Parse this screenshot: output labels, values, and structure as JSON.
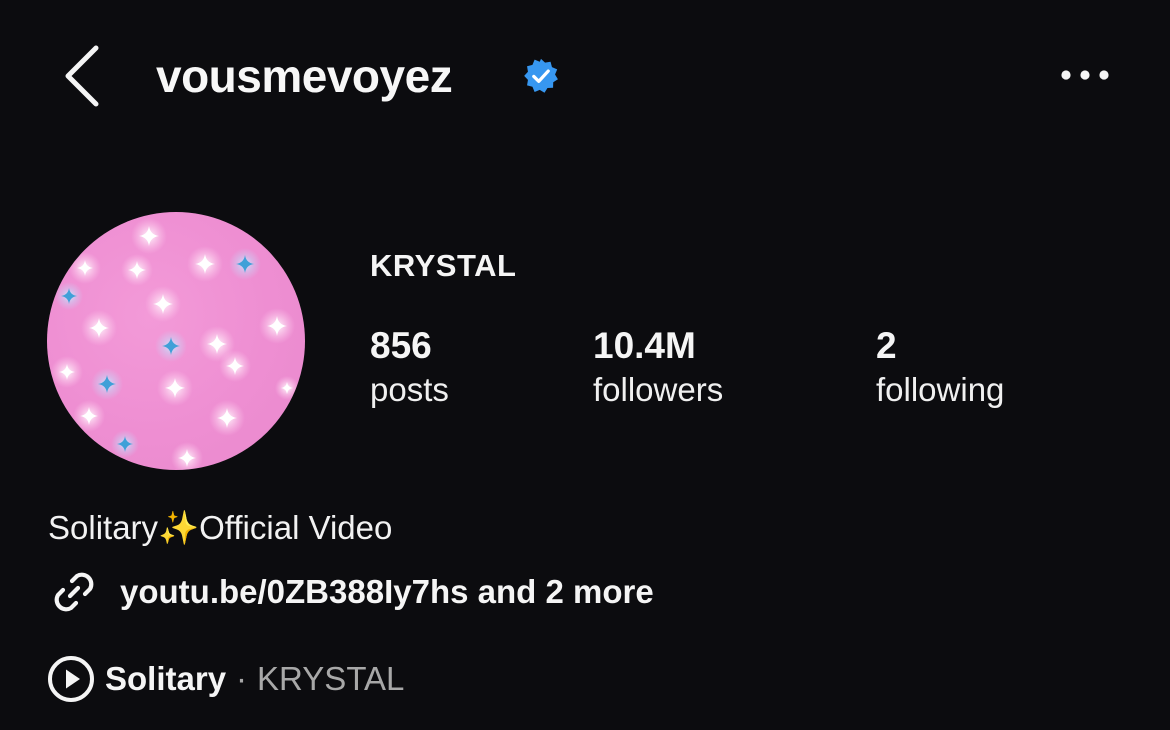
{
  "header": {
    "username": "vousmevoyez",
    "back_icon": "chevron-left-icon",
    "verified_icon": "verified-badge-icon",
    "more_icon": "more-horizontal-icon",
    "verified_color": "#3797f0"
  },
  "profile": {
    "display_name": "KRYSTAL",
    "avatar_colors": {
      "background": "#ee8ed2",
      "star_white": "#ffffff",
      "star_blue": "#3fa0d8"
    }
  },
  "stats": {
    "posts": {
      "value": "856",
      "label": "posts"
    },
    "followers": {
      "value": "10.4M",
      "label": "followers"
    },
    "following": {
      "value": "2",
      "label": "following"
    }
  },
  "bio": {
    "before": "Solitary",
    "emoji": "✨",
    "after": "Official Video"
  },
  "link": {
    "icon": "link-icon",
    "text": "youtu.be/0ZB388Iy7hs and 2 more"
  },
  "music": {
    "icon": "play-circle-icon",
    "title": "Solitary",
    "separator": "·",
    "artist": "KRYSTAL"
  }
}
